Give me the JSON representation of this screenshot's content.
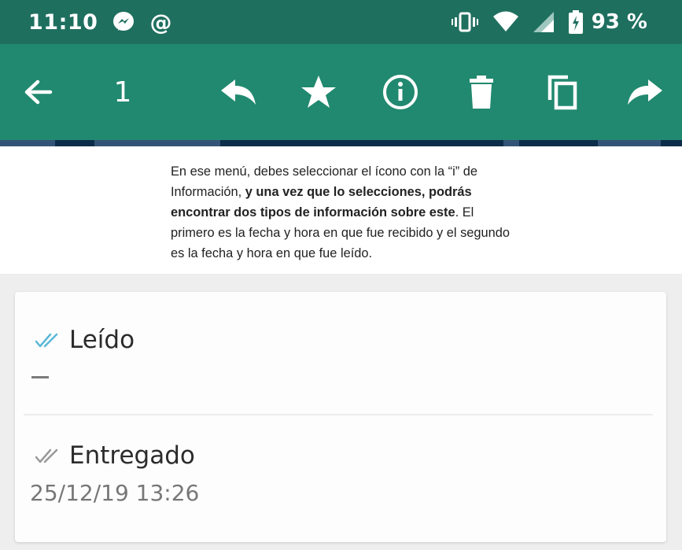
{
  "status_bar": {
    "time": "11:10",
    "battery": "93 %",
    "icons": [
      "messenger-icon",
      "at-icon",
      "vibrate-icon",
      "wifi-icon",
      "signal-icon",
      "battery-charging-icon"
    ]
  },
  "toolbar": {
    "selected_count": "1",
    "actions": [
      "back-arrow-icon",
      "reply-icon",
      "star-icon",
      "info-icon",
      "delete-icon",
      "copy-icon",
      "forward-icon"
    ]
  },
  "article": {
    "part1": "En ese menú, debes seleccionar el ícono con la “i” de Información, ",
    "bold": "y una vez que lo selecciones, podrás encontrar dos tipos de información sobre este",
    "part2": ". El primero es la fecha y hora en que fue recibido y el segundo es la fecha y hora en que fue leído."
  },
  "info": {
    "read_label": "Leído",
    "read_value": "–",
    "delivered_label": "Entregado",
    "delivered_value": "25/12/19 13:26"
  },
  "colors": {
    "status_bar": "#1f6f5f",
    "toolbar": "#21896f",
    "read_tick": "#5bb8d6",
    "delivered_tick": "#9a9a9a"
  }
}
